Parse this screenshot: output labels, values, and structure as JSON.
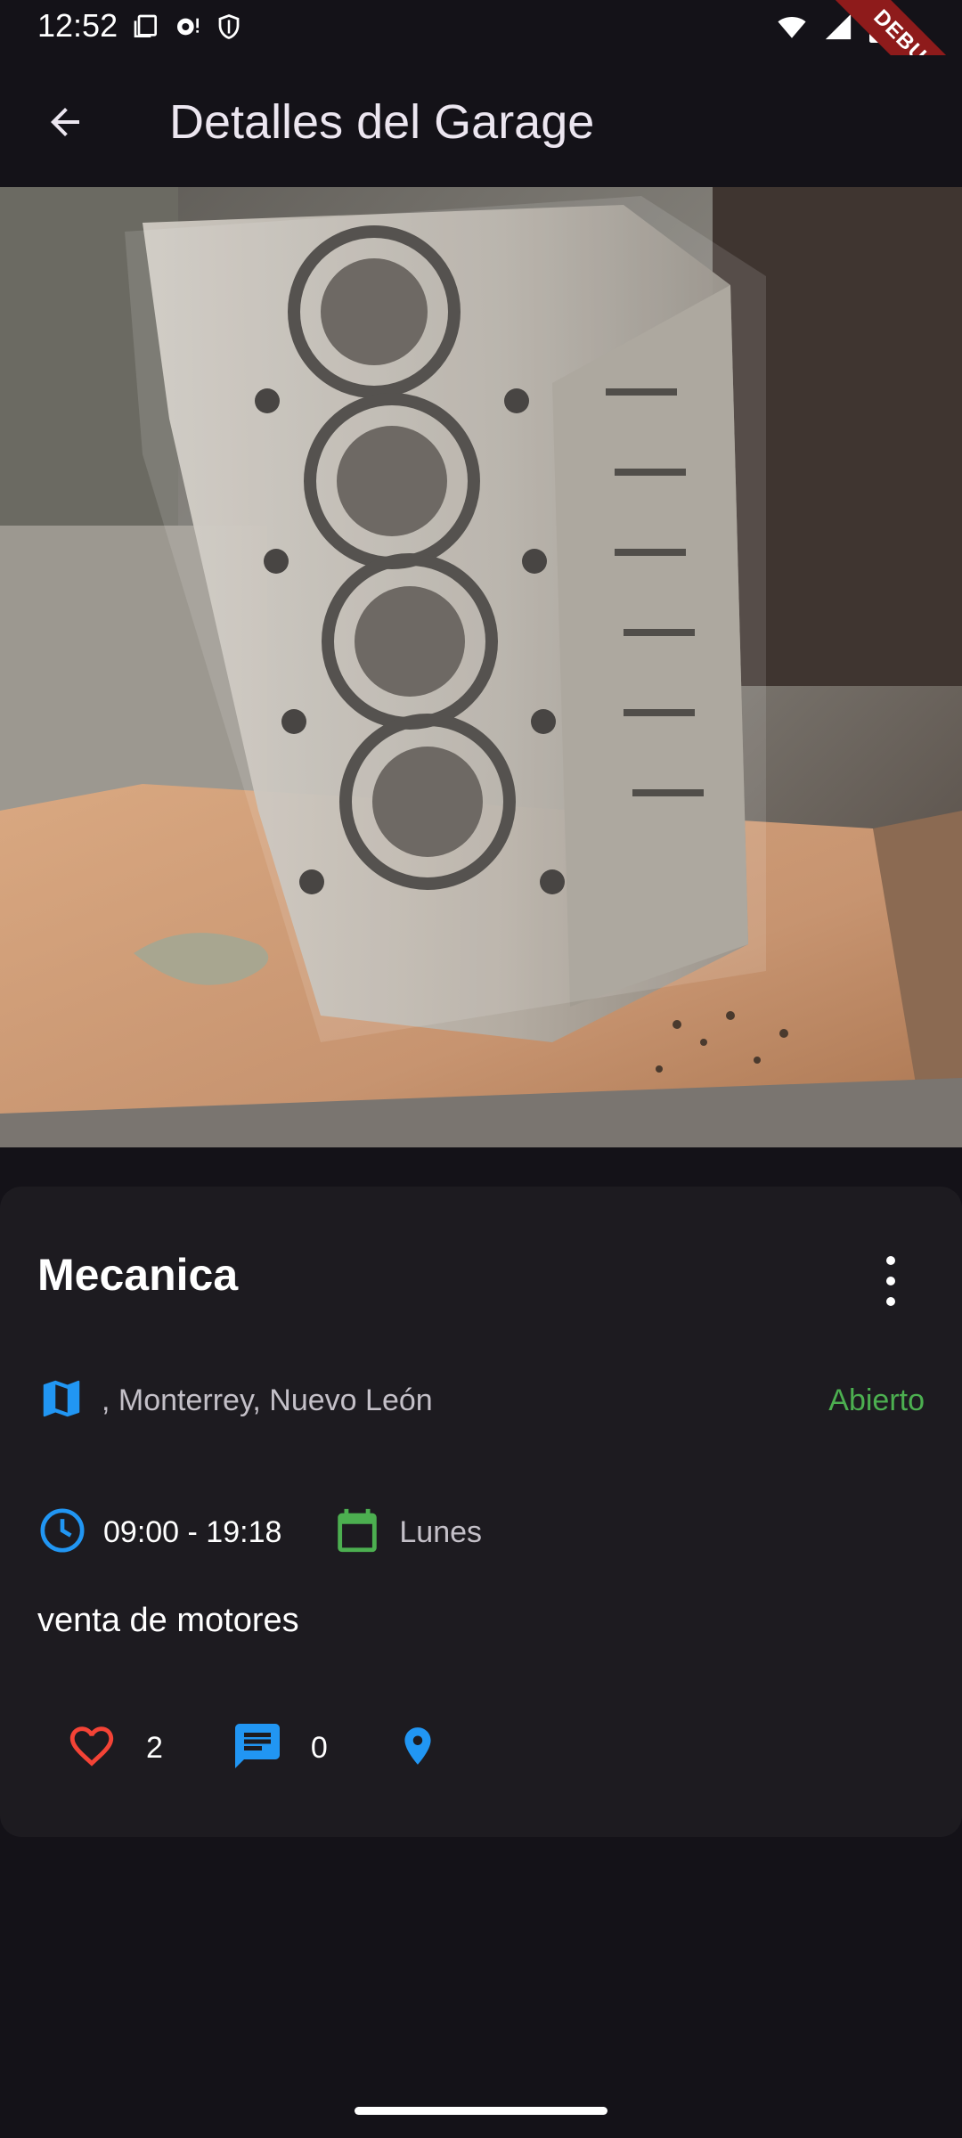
{
  "status_bar": {
    "time": "12:52",
    "debug_label": "DEBUG"
  },
  "app_bar": {
    "title": "Detalles del Garage",
    "back_icon": "arrow-back-icon"
  },
  "garage": {
    "photo_description_icon": "engine-cylinder-head-photo",
    "name": "Mecanica",
    "location": ", Monterrey, Nuevo León",
    "status": "Abierto",
    "hours": "09:00 - 19:18",
    "days": "Lunes",
    "description": "venta de motores",
    "likes": "2",
    "comments": "0"
  },
  "colors": {
    "open_status": "#4CAF50",
    "accent_blue": "#2196F3",
    "heart_red": "#F44336",
    "calendar_green": "#4CAF50"
  }
}
